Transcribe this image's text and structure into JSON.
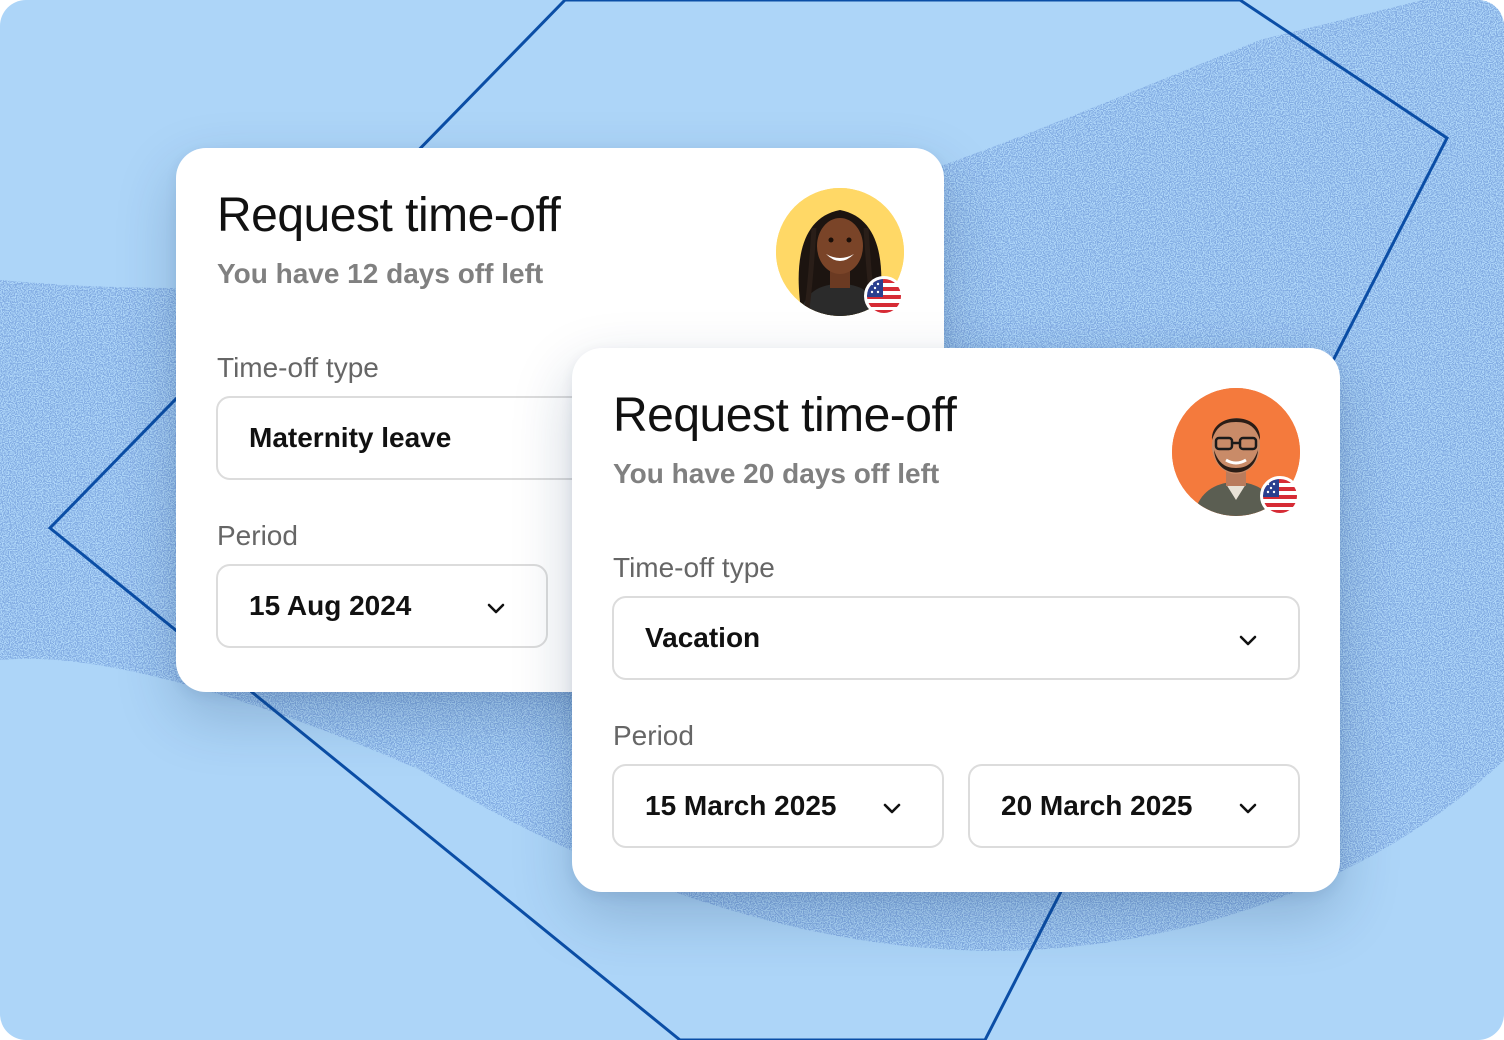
{
  "colors": {
    "background": "#add5f8",
    "card": "#ffffff",
    "line": "#0b4ea6",
    "speckle": "#3f6fc4",
    "title_text": "#111111",
    "subtitle_text": "#808080",
    "field_border": "#dcdcdc",
    "avatar_bg_a": "#ffd866",
    "avatar_bg_b": "#f47a3d"
  },
  "cards": [
    {
      "title": "Request time-off",
      "subtitle": "You have 12 days off left",
      "avatar_icon": "user-avatar-woman",
      "flag_icon": "us-flag-icon",
      "type_label": "Time-off type",
      "type_value": "Maternity leave",
      "period_label": "Period",
      "period_start": "15 Aug 2024"
    },
    {
      "title": "Request time-off",
      "subtitle": "You have 20 days off left",
      "avatar_icon": "user-avatar-man",
      "flag_icon": "us-flag-icon",
      "type_label": "Time-off type",
      "type_value": "Vacation",
      "period_label": "Period",
      "period_start": "15 March 2025",
      "period_end": "20 March 2025"
    }
  ]
}
